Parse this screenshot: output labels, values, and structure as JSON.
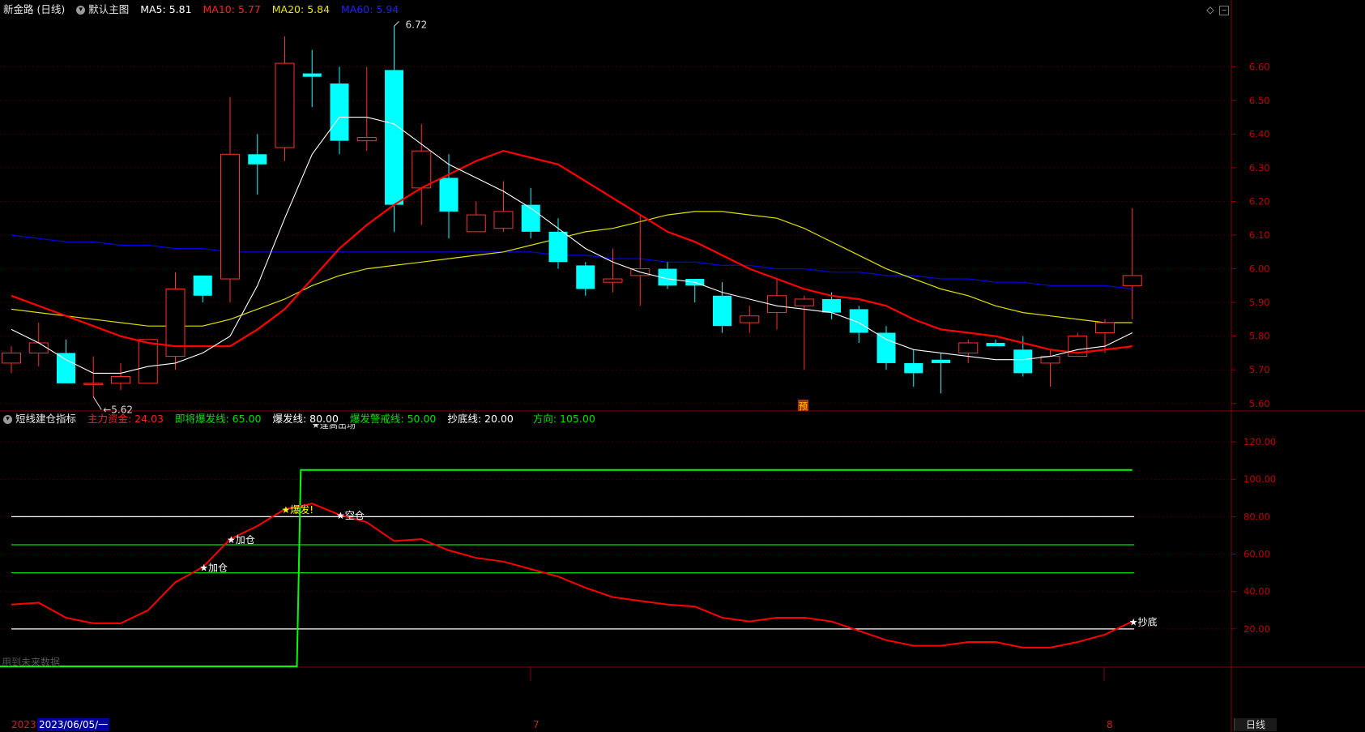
{
  "main_header": {
    "stock": "新金路 (日线)",
    "template": "默认主图",
    "ma5": "MA5: 5.81",
    "ma10": "MA10: 5.77",
    "ma20": "MA20: 5.84",
    "ma60": "MA60: 5.94"
  },
  "indicator_header": {
    "name": "短线建仓指标",
    "main_fund": "主力资金: 24.03",
    "about_to_burst": "即将爆发线: 65.00",
    "burst": "爆发线: 80.00",
    "warning": "爆发警戒线: 50.00",
    "bottom": "抄底线: 20.00",
    "direction": "方向: 105.00"
  },
  "colors": {
    "background": "#000000",
    "grid_red": "#8b0000",
    "up_candle": "#ff3030",
    "down_candle": "#00ffff",
    "ma5": "#ffffff",
    "ma10": "#ff0000",
    "ma20": "#e0e000",
    "ma60": "#0000ee",
    "indicator_line": "#ff0000",
    "direction_line": "#00ff00",
    "level_white": "#ffffff",
    "level_green": "#00dd00",
    "accent_yellow": "#ffff00"
  },
  "annotations": {
    "high_label": "6.72",
    "low_label": "5.62",
    "forecast_marker": "预",
    "future_data_note": "用到未来数据",
    "cut_off_label": "★逢高出场"
  },
  "signals": [
    {
      "label": "★加仓",
      "index": 7
    },
    {
      "label": "★加仓",
      "index": 8
    },
    {
      "label": "★爆发!",
      "index": 10
    },
    {
      "label": "★空仓",
      "index": 12
    },
    {
      "label": "★抄底",
      "index": 41
    }
  ],
  "footer": {
    "date_left": "2023",
    "date_selected": "2023/06/05/一",
    "month7": "7",
    "month8": "8",
    "period_button": "日线"
  },
  "chart_data": [
    {
      "type": "candlestick",
      "yticks": [
        5.6,
        5.7,
        5.8,
        5.9,
        6.0,
        6.1,
        6.2,
        6.3,
        6.4,
        6.5,
        6.6
      ],
      "ylim": [
        5.585,
        6.745
      ],
      "candles": [
        {
          "o": 5.72,
          "h": 5.77,
          "l": 5.69,
          "c": 5.75
        },
        {
          "o": 5.75,
          "h": 5.84,
          "l": 5.71,
          "c": 5.78
        },
        {
          "o": 5.75,
          "h": 5.79,
          "l": 5.66,
          "c": 5.66
        },
        {
          "o": 5.66,
          "h": 5.74,
          "l": 5.62,
          "c": 5.66
        },
        {
          "o": 5.66,
          "h": 5.72,
          "l": 5.64,
          "c": 5.68
        },
        {
          "o": 5.66,
          "h": 5.79,
          "l": 5.66,
          "c": 5.79
        },
        {
          "o": 5.74,
          "h": 5.99,
          "l": 5.7,
          "c": 5.94
        },
        {
          "o": 5.98,
          "h": 5.98,
          "l": 5.9,
          "c": 5.92
        },
        {
          "o": 5.97,
          "h": 6.51,
          "l": 5.9,
          "c": 6.34
        },
        {
          "o": 6.34,
          "h": 6.4,
          "l": 6.22,
          "c": 6.31
        },
        {
          "o": 6.36,
          "h": 6.69,
          "l": 6.32,
          "c": 6.61
        },
        {
          "o": 6.58,
          "h": 6.65,
          "l": 6.48,
          "c": 6.57
        },
        {
          "o": 6.55,
          "h": 6.6,
          "l": 6.34,
          "c": 6.38
        },
        {
          "o": 6.38,
          "h": 6.6,
          "l": 6.35,
          "c": 6.39
        },
        {
          "o": 6.59,
          "h": 6.72,
          "l": 6.11,
          "c": 6.19
        },
        {
          "o": 6.24,
          "h": 6.43,
          "l": 6.13,
          "c": 6.35
        },
        {
          "o": 6.27,
          "h": 6.34,
          "l": 6.09,
          "c": 6.17
        },
        {
          "o": 6.11,
          "h": 6.2,
          "l": 6.11,
          "c": 6.16
        },
        {
          "o": 6.12,
          "h": 6.26,
          "l": 6.11,
          "c": 6.17
        },
        {
          "o": 6.19,
          "h": 6.24,
          "l": 6.09,
          "c": 6.11
        },
        {
          "o": 6.11,
          "h": 6.15,
          "l": 6.0,
          "c": 6.02
        },
        {
          "o": 6.01,
          "h": 6.02,
          "l": 5.92,
          "c": 5.94
        },
        {
          "o": 5.96,
          "h": 6.06,
          "l": 5.93,
          "c": 5.97
        },
        {
          "o": 5.98,
          "h": 6.16,
          "l": 5.89,
          "c": 6.0
        },
        {
          "o": 6.0,
          "h": 6.02,
          "l": 5.94,
          "c": 5.95
        },
        {
          "o": 5.97,
          "h": 5.97,
          "l": 5.9,
          "c": 5.95
        },
        {
          "o": 5.92,
          "h": 5.96,
          "l": 5.81,
          "c": 5.83
        },
        {
          "o": 5.84,
          "h": 5.89,
          "l": 5.81,
          "c": 5.86
        },
        {
          "o": 5.87,
          "h": 5.97,
          "l": 5.82,
          "c": 5.92
        },
        {
          "o": 5.89,
          "h": 5.92,
          "l": 5.7,
          "c": 5.91
        },
        {
          "o": 5.91,
          "h": 5.93,
          "l": 5.85,
          "c": 5.87
        },
        {
          "o": 5.88,
          "h": 5.89,
          "l": 5.78,
          "c": 5.81
        },
        {
          "o": 5.81,
          "h": 5.83,
          "l": 5.7,
          "c": 5.72
        },
        {
          "o": 5.72,
          "h": 5.76,
          "l": 5.65,
          "c": 5.69
        },
        {
          "o": 5.73,
          "h": 5.75,
          "l": 5.63,
          "c": 5.72
        },
        {
          "o": 5.75,
          "h": 5.79,
          "l": 5.72,
          "c": 5.78
        },
        {
          "o": 5.78,
          "h": 5.79,
          "l": 5.77,
          "c": 5.77
        },
        {
          "o": 5.76,
          "h": 5.8,
          "l": 5.68,
          "c": 5.69
        },
        {
          "o": 5.72,
          "h": 5.76,
          "l": 5.65,
          "c": 5.74
        },
        {
          "o": 5.74,
          "h": 5.81,
          "l": 5.74,
          "c": 5.8
        },
        {
          "o": 5.81,
          "h": 5.85,
          "l": 5.75,
          "c": 5.84
        },
        {
          "o": 5.95,
          "h": 6.18,
          "l": 5.85,
          "c": 5.98
        }
      ],
      "ma5": [
        5.82,
        5.78,
        5.73,
        5.69,
        5.69,
        5.71,
        5.72,
        5.75,
        5.8,
        5.95,
        6.15,
        6.34,
        6.45,
        6.45,
        6.43,
        6.37,
        6.31,
        6.27,
        6.23,
        6.18,
        6.12,
        6.06,
        6.02,
        5.99,
        5.97,
        5.96,
        5.93,
        5.91,
        5.89,
        5.88,
        5.87,
        5.84,
        5.79,
        5.76,
        5.75,
        5.74,
        5.73,
        5.73,
        5.74,
        5.76,
        5.77,
        5.81
      ],
      "ma10": [
        5.92,
        5.89,
        5.86,
        5.83,
        5.8,
        5.78,
        5.77,
        5.77,
        5.77,
        5.82,
        5.88,
        5.97,
        6.06,
        6.13,
        6.19,
        6.24,
        6.28,
        6.32,
        6.35,
        6.33,
        6.31,
        6.26,
        6.21,
        6.16,
        6.11,
        6.08,
        6.04,
        6.0,
        5.97,
        5.94,
        5.92,
        5.91,
        5.89,
        5.85,
        5.82,
        5.81,
        5.8,
        5.78,
        5.76,
        5.75,
        5.76,
        5.77
      ],
      "ma20": [
        5.88,
        5.87,
        5.86,
        5.85,
        5.84,
        5.83,
        5.83,
        5.83,
        5.85,
        5.88,
        5.91,
        5.95,
        5.98,
        6.0,
        6.01,
        6.02,
        6.03,
        6.04,
        6.05,
        6.07,
        6.09,
        6.11,
        6.12,
        6.14,
        6.16,
        6.17,
        6.17,
        6.16,
        6.15,
        6.12,
        6.08,
        6.04,
        6.0,
        5.97,
        5.94,
        5.92,
        5.89,
        5.87,
        5.86,
        5.85,
        5.84,
        5.84
      ],
      "ma60": [
        6.1,
        6.09,
        6.08,
        6.08,
        6.07,
        6.07,
        6.06,
        6.06,
        6.05,
        6.05,
        6.05,
        6.05,
        6.05,
        6.05,
        6.05,
        6.05,
        6.05,
        6.05,
        6.05,
        6.05,
        6.04,
        6.04,
        6.03,
        6.03,
        6.02,
        6.02,
        6.01,
        6.01,
        6.0,
        6.0,
        5.99,
        5.99,
        5.98,
        5.98,
        5.97,
        5.97,
        5.96,
        5.96,
        5.95,
        5.95,
        5.95,
        5.94
      ]
    },
    {
      "type": "line",
      "yticks": [
        20,
        40,
        60,
        80,
        100,
        120
      ],
      "ylim": [
        0,
        130
      ],
      "series": [
        {
          "name": "主力资金",
          "values": [
            33,
            34,
            26,
            23,
            23,
            30,
            45,
            53,
            68,
            75,
            84,
            87,
            81,
            77,
            67,
            68,
            62,
            58,
            56,
            52,
            48,
            42,
            37,
            35,
            33,
            32,
            26,
            24,
            26,
            26,
            24,
            19,
            14,
            11,
            11,
            13,
            13,
            10,
            10,
            13,
            17,
            24
          ]
        },
        {
          "name": "方向",
          "values": [
            0,
            0,
            0,
            0,
            0,
            0,
            0,
            0,
            0,
            0,
            0,
            105,
            105,
            105,
            105,
            105,
            105,
            105,
            105,
            105,
            105,
            105,
            105,
            105,
            105,
            105,
            105,
            105,
            105,
            105,
            105,
            105,
            105,
            105,
            105,
            105,
            105,
            105,
            105,
            105,
            105,
            105
          ]
        }
      ],
      "levels": [
        {
          "name": "爆发线",
          "value": 80
        },
        {
          "name": "即将爆发线",
          "value": 65
        },
        {
          "name": "爆发警戒线",
          "value": 50
        },
        {
          "name": "抄底线",
          "value": 20
        }
      ]
    }
  ]
}
